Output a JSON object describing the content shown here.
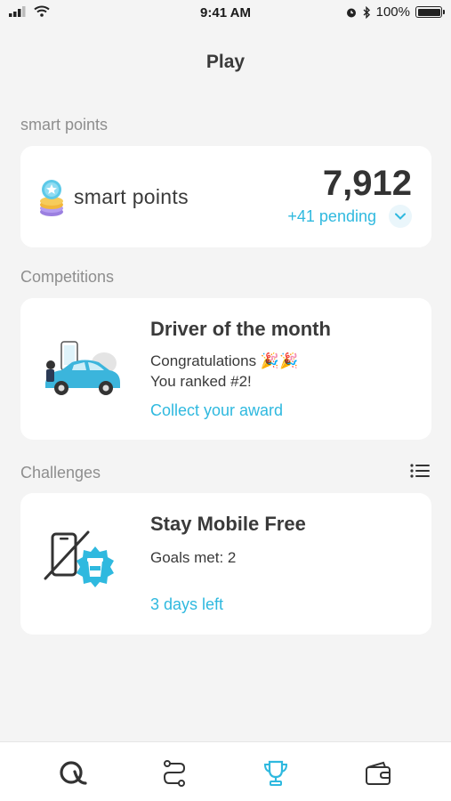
{
  "status_bar": {
    "time": "9:41 AM",
    "battery_percent": "100%"
  },
  "header": {
    "title": "Play"
  },
  "points": {
    "section_label": "smart points",
    "label": "smart points",
    "value": "7,912",
    "pending": "+41 pending"
  },
  "competitions": {
    "section_label": "Competitions",
    "title": "Driver of the month",
    "line1": "Congratulations 🎉🎉",
    "line2": "You ranked #2!",
    "link": "Collect your award"
  },
  "challenges": {
    "section_label": "Challenges",
    "title": "Stay Mobile Free",
    "goals": "Goals met: 2",
    "link": "3 days left"
  },
  "tabs": [
    {
      "name": "home",
      "icon": "q-logo-icon",
      "active": false
    },
    {
      "name": "trips",
      "icon": "route-icon",
      "active": false
    },
    {
      "name": "play",
      "icon": "trophy-icon",
      "active": true
    },
    {
      "name": "wallet",
      "icon": "wallet-icon",
      "active": false
    }
  ],
  "colors": {
    "accent": "#2fb9df",
    "background": "#f4f4f4",
    "card": "#ffffff",
    "text": "#3a3a3a"
  }
}
